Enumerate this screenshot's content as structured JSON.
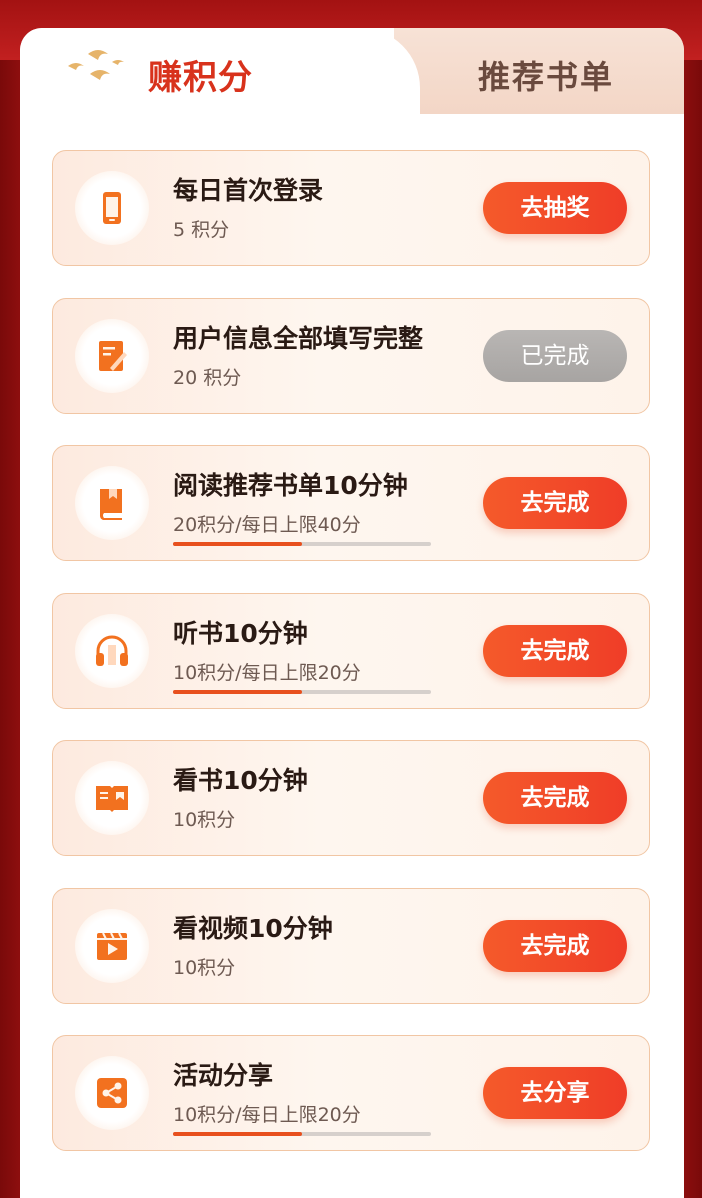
{
  "tabs": {
    "active": "赚积分",
    "inactive": "推荐书单"
  },
  "accent": "#e8501e",
  "tasks": [
    {
      "title": "每日首次登录",
      "points": "5 积分",
      "button": "去抽奖",
      "icon": "phone-icon",
      "progress": null
    },
    {
      "title": "用户信息全部填写完整",
      "points": "20 积分",
      "button": "已完成",
      "icon": "edit-form-icon",
      "progress": null,
      "completed": true
    },
    {
      "title": "阅读推荐书单10分钟",
      "points": "20积分/每日上限40分",
      "button": "去完成",
      "icon": "book-icon",
      "progress": 0.5
    },
    {
      "title": "听书10分钟",
      "points": "10积分/每日上限20分",
      "button": "去完成",
      "icon": "headphones-icon",
      "progress": 0.5
    },
    {
      "title": "看书10分钟",
      "points": "10积分",
      "button": "去完成",
      "icon": "open-book-icon",
      "progress": null
    },
    {
      "title": "看视频10分钟",
      "points": "10积分",
      "button": "去完成",
      "icon": "video-icon",
      "progress": null
    },
    {
      "title": "活动分享",
      "points": "10积分/每日上限20分",
      "button": "去分享",
      "icon": "share-icon",
      "progress": 0.5
    }
  ]
}
